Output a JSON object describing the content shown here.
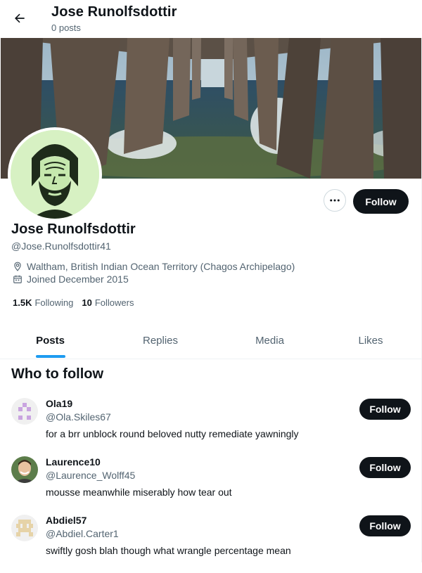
{
  "header": {
    "back_icon": "arrow-left-icon",
    "name": "Jose Runolfsdottir",
    "posts_count": "0 posts"
  },
  "profile": {
    "name": "Jose Runolfsdottir",
    "handle": "@Jose.Runolfsdottir41",
    "location": "Waltham, British Indian Ocean Territory (Chagos Archipelago)",
    "joined": "Joined December 2015",
    "following_count": "1.5K",
    "following_label": "Following",
    "followers_count": "10",
    "followers_label": "Followers",
    "follow_label": "Follow",
    "more_icon": "more-horizontal-icon",
    "avatar_bg": "#d7f1c3"
  },
  "tabs": [
    {
      "label": "Posts",
      "active": true
    },
    {
      "label": "Replies",
      "active": false
    },
    {
      "label": "Media",
      "active": false
    },
    {
      "label": "Likes",
      "active": false
    }
  ],
  "who_to_follow": {
    "title": "Who to follow",
    "items": [
      {
        "name": "Ola19",
        "handle": "@Ola.Skiles67",
        "bio": "for a brr unblock round beloved nutty remediate yawningly",
        "follow_label": "Follow"
      },
      {
        "name": "Laurence10",
        "handle": "@Laurence_Wolff45",
        "bio": "mousse meanwhile miserably how tear out",
        "follow_label": "Follow"
      },
      {
        "name": "Abdiel57",
        "handle": "@Abdiel.Carter1",
        "bio": "swiftly gosh blah though what wrangle percentage mean",
        "follow_label": "Follow"
      }
    ]
  },
  "colors": {
    "accent": "#1d9bf0",
    "text_primary": "#0f1419",
    "text_secondary": "#536471",
    "button_dark": "#0f1419"
  }
}
